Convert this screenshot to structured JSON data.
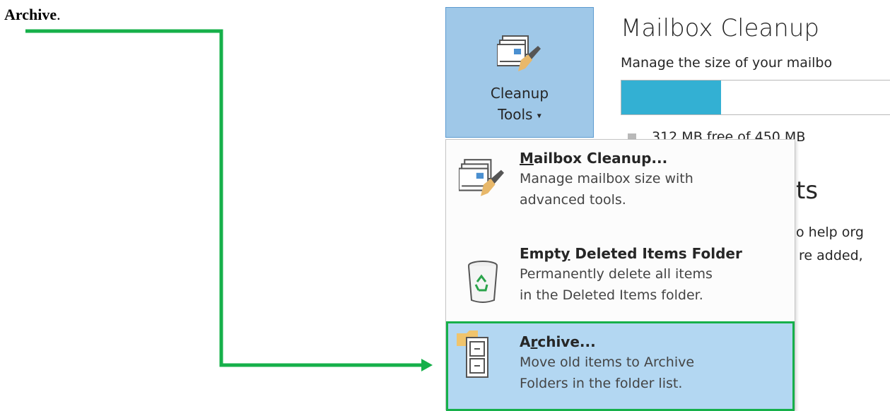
{
  "doc": {
    "text": "Archive",
    "suffix": "."
  },
  "ribbon": {
    "cleanup_tools": {
      "line1": "Cleanup",
      "line2": "Tools",
      "caret": "▾"
    }
  },
  "panel": {
    "title": "Mailbox Cleanup",
    "description": "Manage the size of your mailbo",
    "quota": {
      "used_fraction": 0.37,
      "legend": "312 MB free of 450 MB"
    },
    "partial_heading": "ts",
    "partial_line1": "o help org",
    "partial_line2": "re added,"
  },
  "menu": {
    "items": [
      {
        "title_accel": "M",
        "title_rest": "ailbox Cleanup...",
        "desc1": "Manage mailbox size with",
        "desc2": "advanced tools."
      },
      {
        "title_pre": "Empt",
        "title_accel": "y",
        "title_rest": " Deleted Items Folder",
        "desc1": "Permanently delete all items",
        "desc2": "in the Deleted Items folder."
      },
      {
        "title_pre": "A",
        "title_accel": "r",
        "title_rest": "chive...",
        "desc1": "Move old items to Archive",
        "desc2": "Folders in the folder list."
      }
    ]
  },
  "colors": {
    "highlight_border": "#16b04a",
    "button_bg": "#9fc8e8",
    "selected_bg": "#b3d7f2",
    "quota_fill": "#33b0d3"
  },
  "icons": [
    "mailbox-cleanup-icon",
    "recycle-bin-icon",
    "archive-cabinet-icon",
    "dropdown-caret-icon"
  ]
}
